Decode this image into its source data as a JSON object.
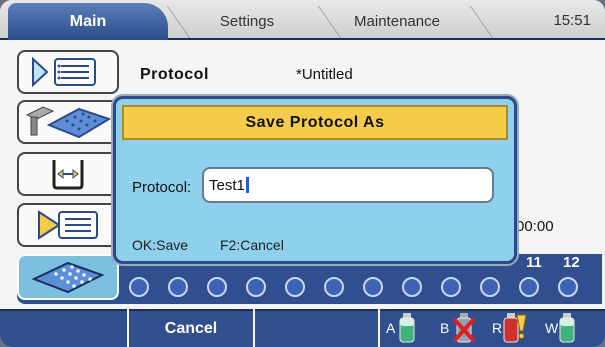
{
  "tabs": [
    {
      "label": "Main"
    },
    {
      "label": "Settings"
    },
    {
      "label": "Maintenance"
    }
  ],
  "clock": "15:51",
  "protocol": {
    "label": "Protocol",
    "value": "*Untitled"
  },
  "time_value": "00:00",
  "plate": {
    "column_labels": [
      "11",
      "12"
    ],
    "well_count": 12
  },
  "dialog": {
    "title": "Save Protocol As",
    "field_label": "Protocol:",
    "field_value": "Test1",
    "hint_ok": "OK:Save",
    "hint_cancel": "F2:Cancel"
  },
  "bottom": {
    "cancel_label": "Cancel",
    "bottles": [
      {
        "label": "A",
        "icon": "bottle-green-icon"
      },
      {
        "label": "B",
        "icon": "bottle-missing-icon"
      },
      {
        "label": "R",
        "icon": "bottle-red-warning-icon"
      },
      {
        "label": "W",
        "icon": "bottle-green-icon"
      }
    ]
  },
  "colors": {
    "accent": "#2f4f8f",
    "dialog_bg": "#8fd0ec",
    "dialog_title": "#f5cc4a",
    "well": "#3d63b5"
  }
}
